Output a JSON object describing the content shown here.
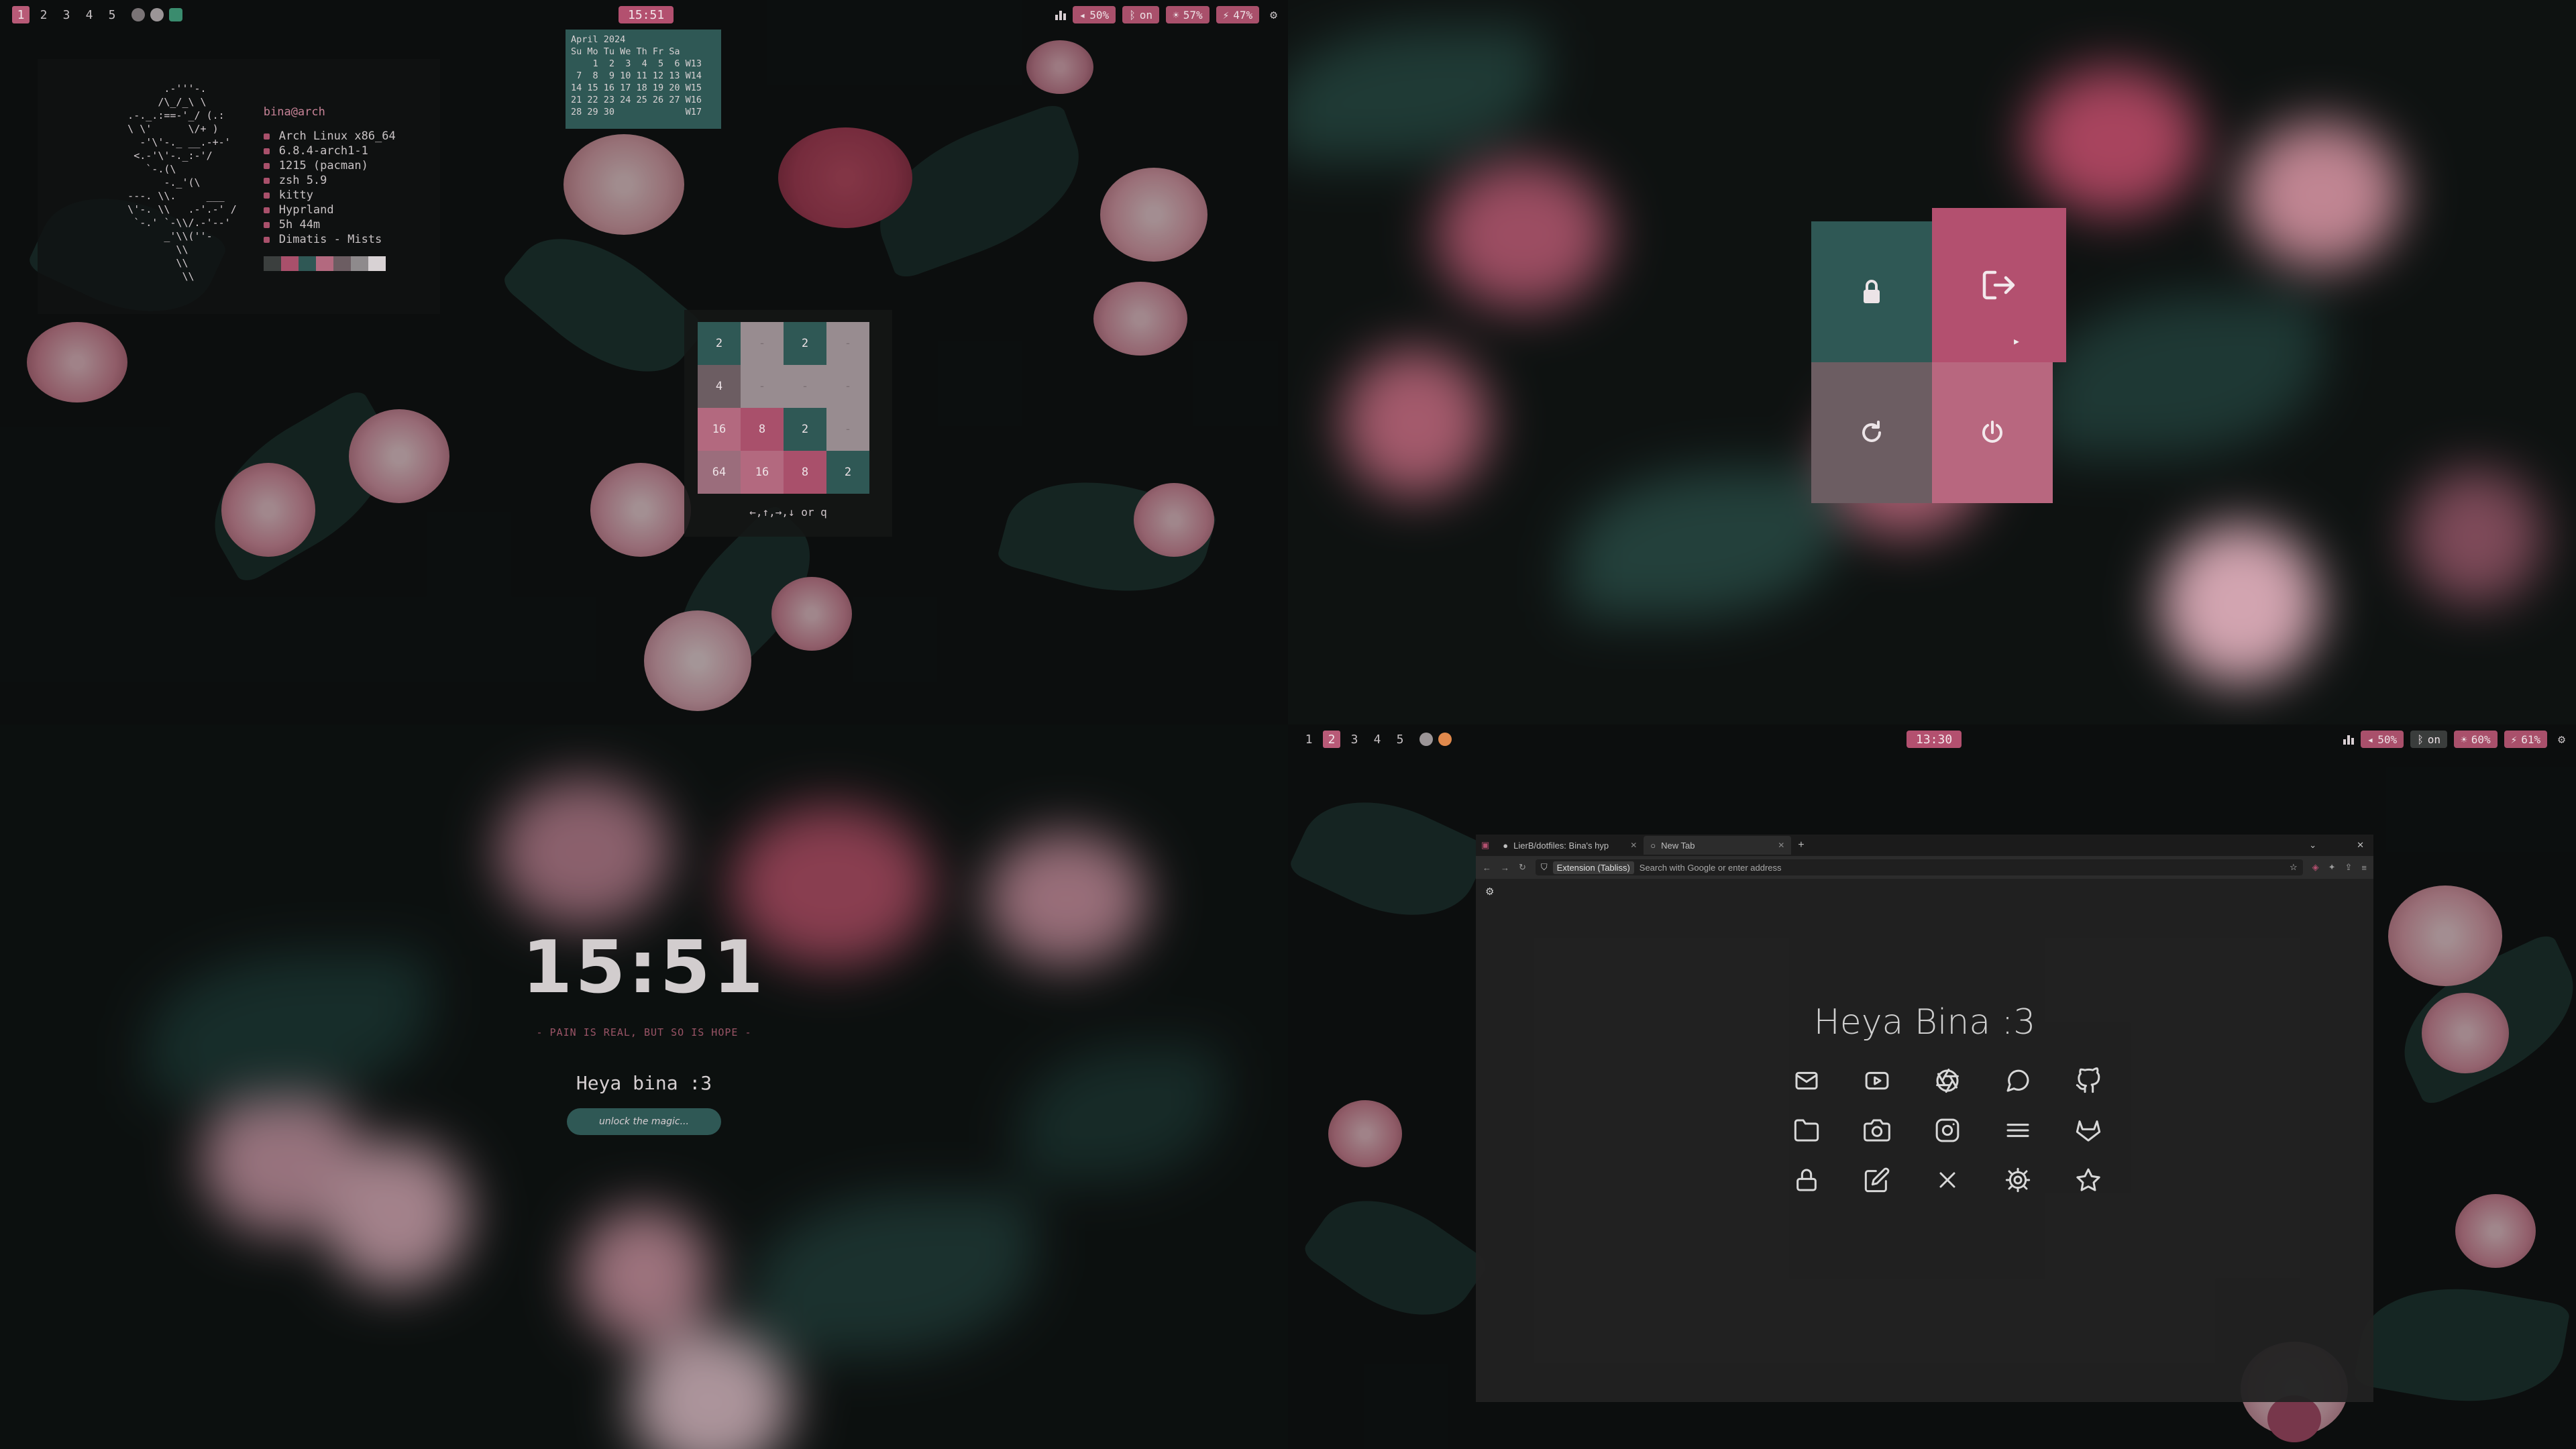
{
  "colors": {
    "accent_pink": "#b3506f",
    "accent_teal": "#2f5855",
    "muted_mauve": "#6c5d62",
    "soft_pink": "#b8677f"
  },
  "top_left": {
    "bar": {
      "workspaces": [
        "1",
        "2",
        "3",
        "4",
        "5"
      ],
      "active_workspace": "1",
      "clock": "15:51",
      "modules": [
        {
          "icon": "speaker-icon",
          "text": "50%"
        },
        {
          "icon": "bluetooth-icon",
          "text": "on"
        },
        {
          "icon": "brightness-icon",
          "text": "57%"
        },
        {
          "icon": "battery-icon",
          "text": "47%"
        }
      ]
    },
    "fetch": {
      "user": "bina@arch",
      "ascii_art": "            .-'''-.\n           /\\_/_\\ \\\n      .-._.:==-'_/ (.:\n      \\ \\'      \\/+ )\n        -'\\'-._ __.-+-'\n       <.-'\\'-._:-'/\n         `-.(\\\n            -._'(\\\n      ---. \\\\.     ___\n      \\'-. \\\\   .-'.-' /\n       `-.' `-\\\\/.-'--'\n            _'\\\\(''-\n              \\\\\n              \\\\\n               \\\\",
      "lines": [
        "Arch Linux x86_64",
        "6.8.4-arch1-1",
        "1215 (pacman)",
        "zsh 5.9",
        "kitty",
        "Hyprland",
        "5h 44m",
        "Dimatis - Mists"
      ]
    },
    "calendar": "April 2024\nSu Mo Tu We Th Fr Sa\n    1  2  3  4  5  6 W13\n 7  8  9 10 11 12 13 W14\n14 15 16 17 18 19 20 W15\n21 22 23 24 25 26 27 W16\n28 29 30             W17",
    "game": {
      "tiles": [
        [
          "2",
          "-",
          "2",
          "-"
        ],
        [
          "4",
          "-",
          "-",
          "-"
        ],
        [
          "16",
          "8",
          "2",
          "-"
        ],
        [
          "64",
          "16",
          "8",
          "2"
        ]
      ],
      "hint": "←,↑,→,↓ or q"
    }
  },
  "top_right": {
    "power_menu": {
      "lock_icon": "lock-icon",
      "logout_icon": "logout-icon",
      "reboot_icon": "reboot-icon",
      "shutdown_icon": "power-icon"
    }
  },
  "bottom_left": {
    "lock_screen": {
      "time": "15:51",
      "quote": "- PAIN IS REAL, BUT SO IS HOPE -",
      "greeting": "Heya bina :3",
      "input_placeholder": "unlock the magic..."
    }
  },
  "bottom_right": {
    "bar": {
      "workspaces": [
        "1",
        "2",
        "3",
        "4",
        "5"
      ],
      "active_workspace": "2",
      "clock": "13:30",
      "modules": [
        {
          "icon": "speaker-icon",
          "text": "50%"
        },
        {
          "icon": "bluetooth-icon",
          "text": "on"
        },
        {
          "icon": "brightness-icon",
          "text": "60%"
        },
        {
          "icon": "battery-icon",
          "text": "61%"
        }
      ]
    },
    "browser": {
      "tabs": [
        {
          "label": "LierB/dotfiles: Bina's hyp",
          "active": false
        },
        {
          "label": "New Tab",
          "active": true
        }
      ],
      "extension_chip": "Extension (Tabliss)",
      "url_placeholder": "Search with Google or enter address",
      "greeting": "Heya Bina :3",
      "shortcuts": [
        "mail-icon",
        "youtube-icon",
        "aperture-icon",
        "chat-icon",
        "github-icon",
        "folder-icon",
        "camera-icon",
        "instagram-icon",
        "menu-icon",
        "gitlab-icon",
        "lock-icon",
        "edit-icon",
        "close-icon",
        "settings-icon",
        "star-icon"
      ]
    }
  }
}
